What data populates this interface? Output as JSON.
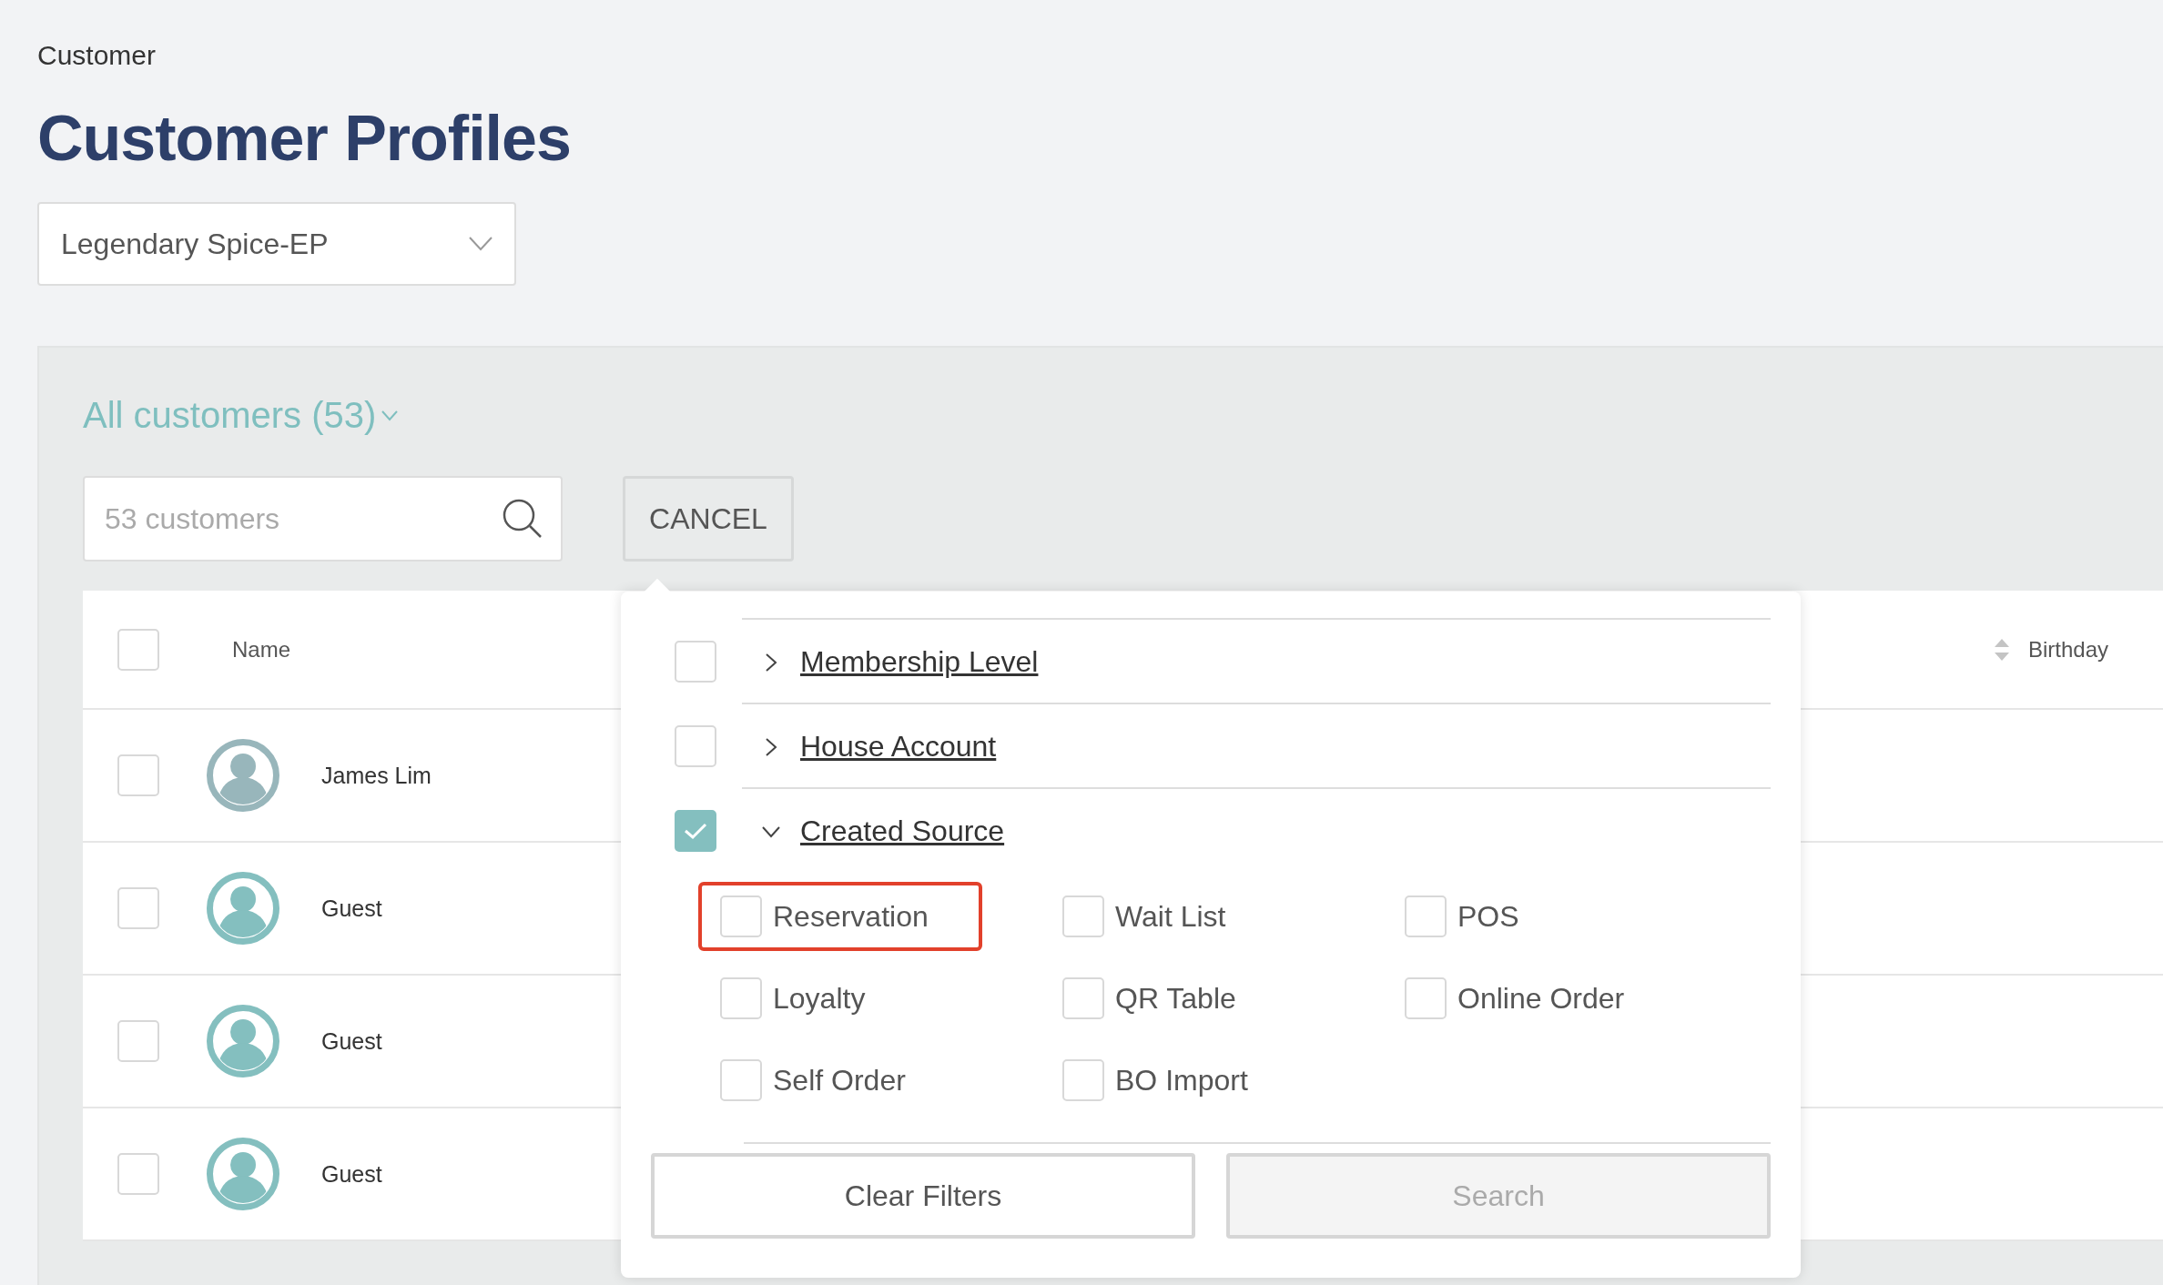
{
  "breadcrumb": "Customer",
  "title": "Customer Profiles",
  "store_select": {
    "value": "Legendary Spice-EP"
  },
  "segment": {
    "label": "All customers (53)"
  },
  "search": {
    "placeholder": "53 customers"
  },
  "cancel_button": "CANCEL",
  "table": {
    "columns": [
      {
        "label": "Name"
      },
      {
        "label": "Birthday",
        "sortable": true
      }
    ],
    "rows": [
      {
        "name": "James Lim",
        "selected": false,
        "color": "#98b6bb"
      },
      {
        "name": "Guest",
        "selected": false,
        "color": "#84bfbf"
      },
      {
        "name": "Guest",
        "selected": false,
        "color": "#84bfbf"
      },
      {
        "name": "Guest",
        "selected": false,
        "color": "#84bfbf"
      }
    ],
    "header_checked": false
  },
  "filter_popover": {
    "filters": [
      {
        "label": "Membership Level",
        "checked": false,
        "expanded": false
      },
      {
        "label": "House Account",
        "checked": false,
        "expanded": false
      },
      {
        "label": "Created Source",
        "checked": true,
        "expanded": true,
        "options": [
          {
            "label": "Reservation",
            "checked": false,
            "highlighted": true
          },
          {
            "label": "Wait List",
            "checked": false,
            "highlighted": false
          },
          {
            "label": "POS",
            "checked": false,
            "highlighted": false
          },
          {
            "label": "Loyalty",
            "checked": false,
            "highlighted": false
          },
          {
            "label": "QR Table",
            "checked": false,
            "highlighted": false
          },
          {
            "label": "Online Order",
            "checked": false,
            "highlighted": false
          },
          {
            "label": "Self Order",
            "checked": false,
            "highlighted": false
          },
          {
            "label": "BO Import",
            "checked": false,
            "highlighted": false
          }
        ]
      }
    ],
    "buttons": [
      {
        "label": "Clear Filters",
        "disabled": false
      },
      {
        "label": "Search",
        "disabled": true
      }
    ]
  }
}
